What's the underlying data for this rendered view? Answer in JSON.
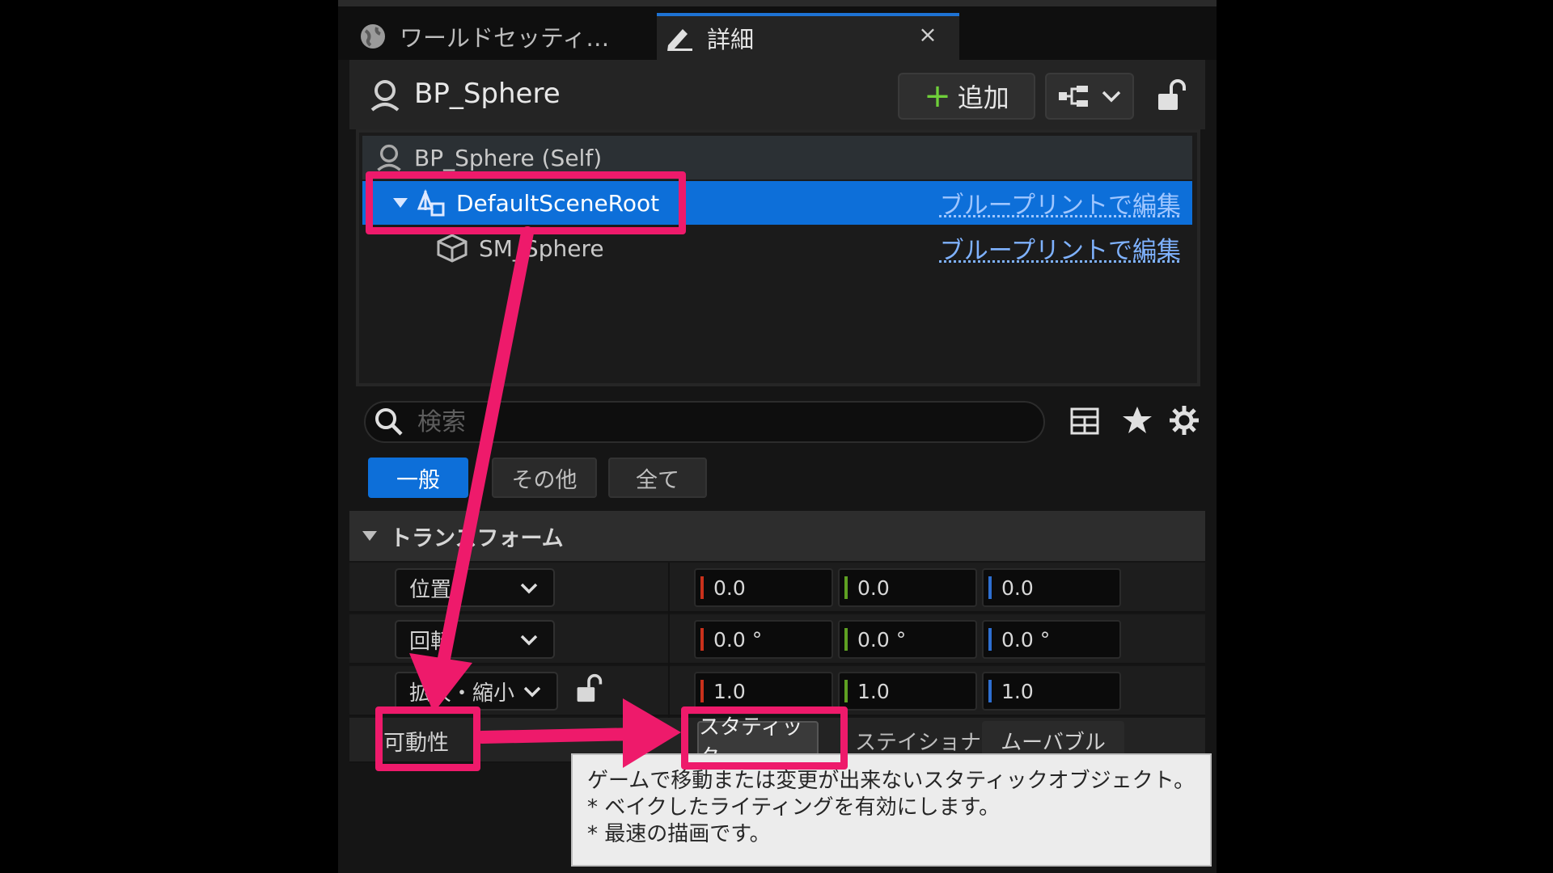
{
  "tabs": [
    {
      "label": "ワールドセッティ…",
      "icon": "globe-icon"
    },
    {
      "label": "詳細",
      "icon": "pencil-edit-icon",
      "close": "×"
    }
  ],
  "header": {
    "actor_name": "BP_Sphere",
    "add_label": "追加"
  },
  "tree": {
    "self_label": "BP_Sphere (Self)",
    "root_label": "DefaultSceneRoot",
    "mesh_label": "SM_Sphere",
    "edit_link": "ブループリントで編集"
  },
  "search": {
    "placeholder": "検索"
  },
  "filter_tabs": [
    "一般",
    "その他",
    "全て"
  ],
  "transform": {
    "section_title": "トランスフォーム",
    "location_label": "位置",
    "rotation_label": "回転",
    "scale_label": "拡大・縮小",
    "location": [
      "0.0",
      "0.0",
      "0.0"
    ],
    "rotation": [
      "0.0 °",
      "0.0 °",
      "0.0 °"
    ],
    "scale": [
      "1.0",
      "1.0",
      "1.0"
    ],
    "mobility_label": "可動性",
    "mobility_options": [
      "スタティック",
      "ステイショナ",
      "ムーバブル"
    ]
  },
  "tooltip": {
    "line1": "ゲームで移動または変更が出来ないスタティックオブジェクト。",
    "line2": "* ベイクしたライティングを有効にします。",
    "line3": "* 最速の描画です。"
  },
  "colors": {
    "selection": "#0d6fd9",
    "annotation": "#ee1a6b",
    "x_axis": "#c9311b",
    "y_axis": "#5ea022",
    "z_axis": "#2d6fd1"
  }
}
